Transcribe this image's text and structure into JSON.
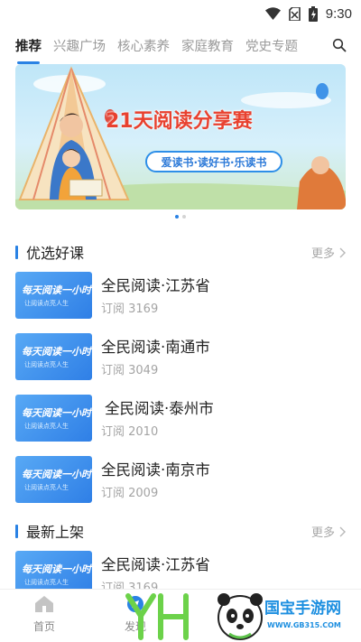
{
  "status": {
    "time": "9:30",
    "icons": [
      "wifi-icon",
      "no-sim-icon",
      "battery-charging-icon"
    ]
  },
  "tabs": [
    {
      "label": "推荐",
      "active": true
    },
    {
      "label": "兴趣广场",
      "active": false
    },
    {
      "label": "核心素养",
      "active": false
    },
    {
      "label": "家庭教育",
      "active": false
    },
    {
      "label": "党史专题",
      "active": false
    }
  ],
  "banner": {
    "title": "21天阅读分享赛",
    "slogan": "爱读书·读好书·乐读书",
    "slide_index": 1,
    "slide_count": 2
  },
  "sections": [
    {
      "title": "优选好课",
      "more": "更多",
      "items": [
        {
          "title": "全民阅读·江苏省",
          "subscribe": "订阅 3169",
          "thumb_title": "每天阅读一小时",
          "thumb_sub": "让阅读点亮人生"
        },
        {
          "title": "全民阅读·南通市",
          "subscribe": "订阅 3049",
          "thumb_title": "每天阅读一小时",
          "thumb_sub": "让阅读点亮人生"
        },
        {
          "title": "全民阅读·泰州市",
          "subscribe": "订阅 2010",
          "thumb_title": "每天阅读一小时",
          "thumb_sub": "让阅读点亮人生"
        },
        {
          "title": "全民阅读·南京市",
          "subscribe": "订阅 2009",
          "thumb_title": "每天阅读一小时",
          "thumb_sub": "让阅读点亮人生"
        }
      ]
    },
    {
      "title": "最新上架",
      "more": "更多",
      "items": [
        {
          "title": "全民阅读·江苏省",
          "subscribe": "订阅 3169",
          "thumb_title": "每天阅读一小时",
          "thumb_sub": "让阅读点亮人生"
        }
      ]
    }
  ],
  "bottom_nav": [
    {
      "label": "首页",
      "icon": "home-icon",
      "active": true
    },
    {
      "label": "发现",
      "icon": "discover-icon",
      "active": false
    }
  ],
  "watermark": {
    "text": "YH",
    "site_name": "国宝手游网",
    "site_url": "WWW.GB315.COM"
  },
  "colors": {
    "accent": "#2a82e4",
    "banner_title": "#e8412f",
    "watermark": "#1d8fe0"
  }
}
